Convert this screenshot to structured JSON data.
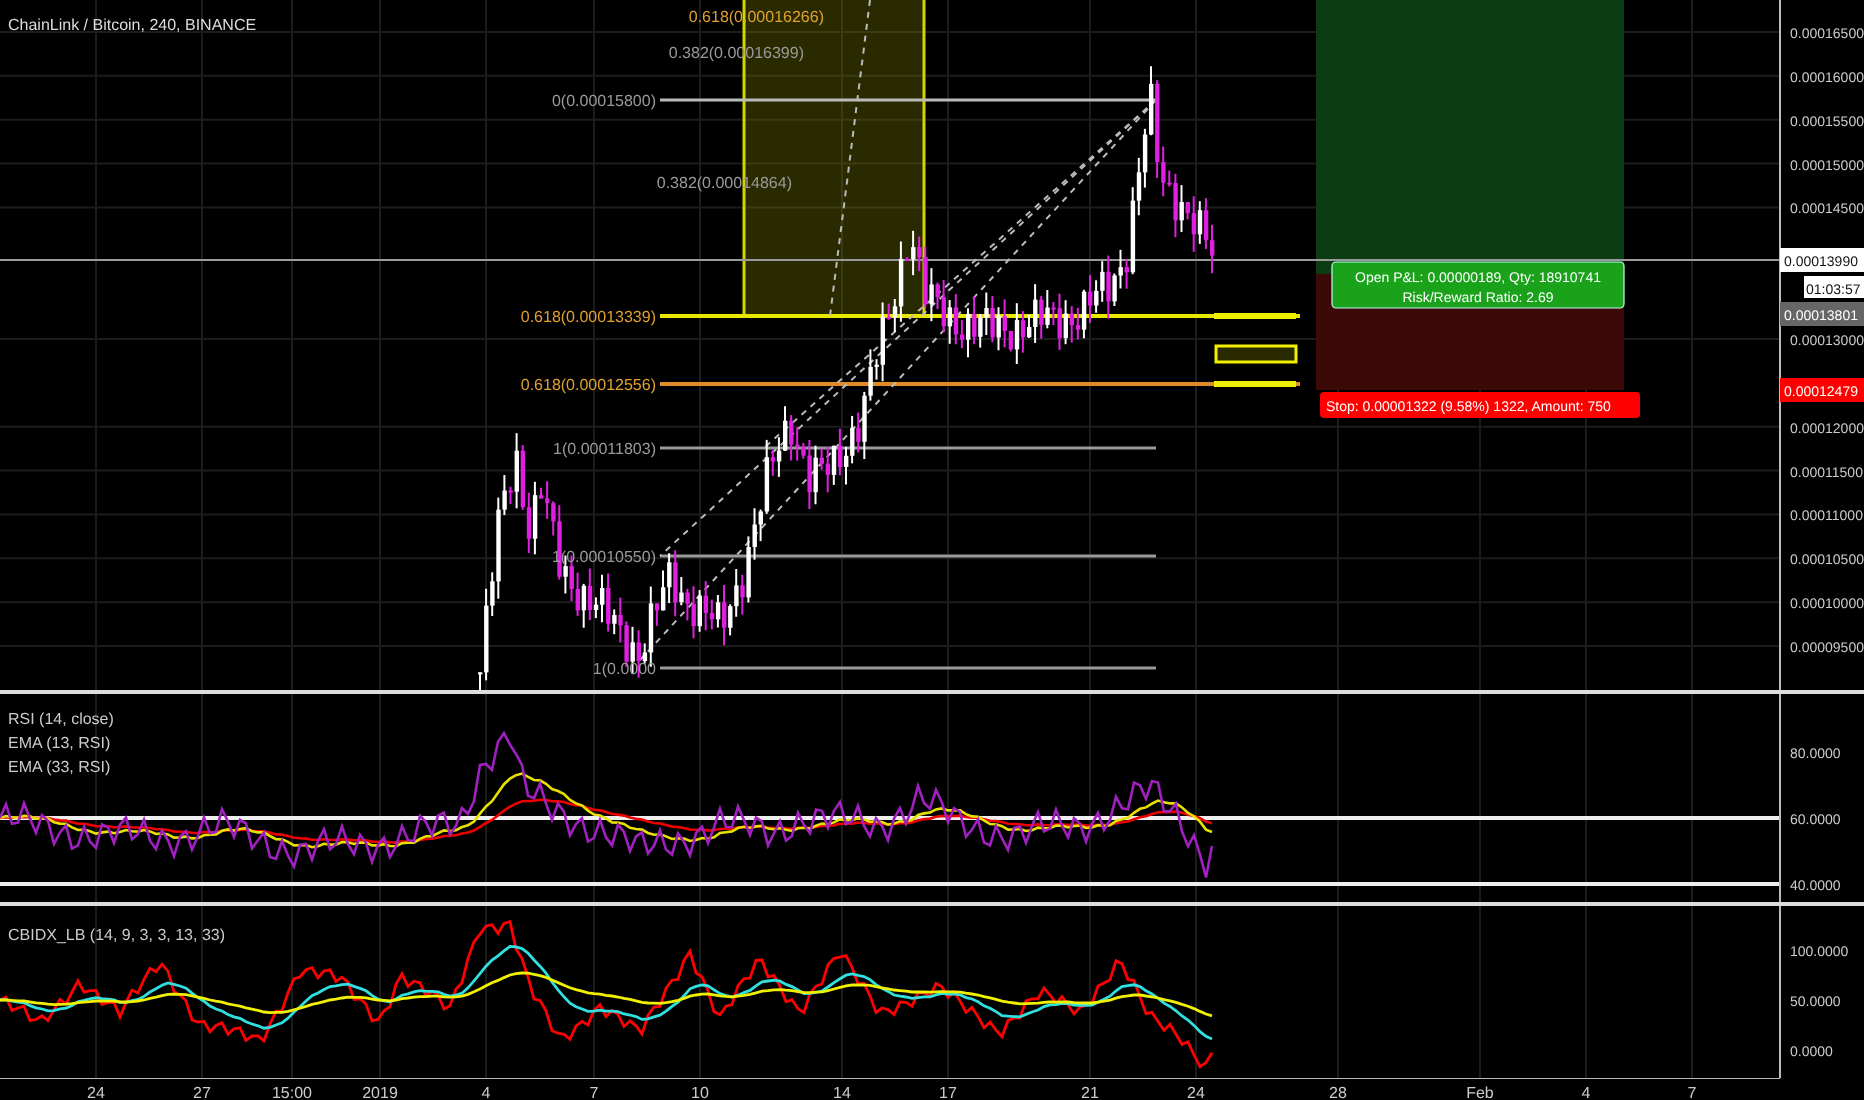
{
  "chart": {
    "title": "ChainLink / Bitcoin, 240, BINANCE",
    "price_ticks": [
      "0.00016500",
      "0.00016000",
      "0.00015500",
      "0.00015000",
      "0.00014500",
      "0.00013000",
      "0.00012000",
      "0.00011500",
      "0.00011000",
      "0.00010500",
      "0.00010000",
      "0.00009500"
    ],
    "price_tags": [
      {
        "text": "0.00013990",
        "kind": "last"
      },
      {
        "text": "01:03:57",
        "kind": "countdown"
      },
      {
        "text": "0.00013801",
        "kind": "marker"
      },
      {
        "text": "0.00012479",
        "kind": "stop"
      }
    ],
    "fib_labels": [
      {
        "text": "0.618(0.00016266)",
        "kind": "orange"
      },
      {
        "text": "0.382(0.00016399)",
        "kind": "gray"
      },
      {
        "text": "0(0.00015800)",
        "kind": "gray"
      },
      {
        "text": "0.382(0.00014864)",
        "kind": "gray"
      },
      {
        "text": "0.618(0.00013339)",
        "kind": "orange"
      },
      {
        "text": "0.618(0.00012556)",
        "kind": "orange"
      },
      {
        "text": "1(0.00011803)",
        "kind": "gray"
      },
      {
        "text": "1(0.00010550)",
        "kind": "gray"
      },
      {
        "text": "1(0.0000",
        "kind": "gray"
      }
    ],
    "position": {
      "pnl": "Open P&L: 0.00000189, Qty: 18910741",
      "ratio": "Risk/Reward Ratio: 2.69",
      "stop": "Stop: 0.00001322 (9.58%) 1322, Amount: 750"
    }
  },
  "rsi": {
    "legend": [
      "RSI (14, close)",
      "EMA (13, RSI)",
      "EMA (33, RSI)"
    ],
    "ticks": [
      "80.0000",
      "60.0000",
      "40.0000"
    ]
  },
  "cbidx": {
    "legend": "CBIDX_LB (14, 9, 3, 3, 13, 33)",
    "ticks": [
      "100.0000",
      "50.0000",
      "0.0000"
    ]
  },
  "time_axis": [
    "24",
    "27",
    "15:00",
    "2019",
    "4",
    "7",
    "10",
    "14",
    "17",
    "21",
    "24",
    "28",
    "Feb",
    "4",
    "7"
  ]
}
